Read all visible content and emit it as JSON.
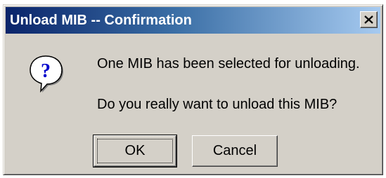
{
  "window": {
    "title": "Unload MIB -- Confirmation",
    "close_label": "×"
  },
  "message": {
    "line1": "One MIB has been selected for unloading.",
    "line2": "Do you really want to unload this MIB?"
  },
  "icon": {
    "name": "question-icon",
    "glyph": "?"
  },
  "buttons": {
    "ok_label": "OK",
    "cancel_label": "Cancel"
  },
  "colors": {
    "title_start": "#0a246a",
    "title_end": "#a6caf0",
    "dialog_bg": "#d4d0c8"
  }
}
